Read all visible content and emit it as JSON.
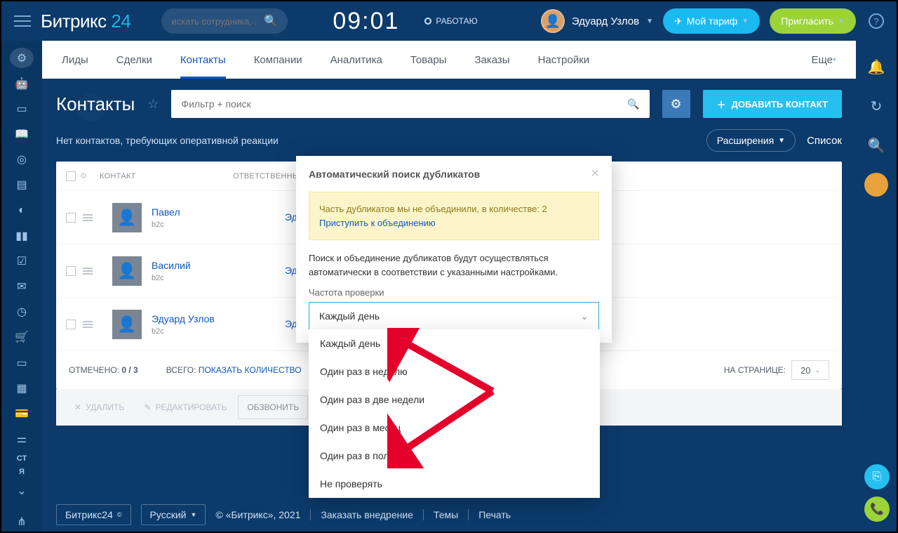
{
  "logo": {
    "a": "Битрикс",
    "b": "24"
  },
  "global_search_placeholder": "искать сотрудника, ...",
  "clock": "09:01",
  "status": "РАБОТАЮ",
  "user_name": "Эдуард Узлов",
  "btn_tarif": "Мой тариф",
  "btn_invite": "Пригласить",
  "tabs": [
    "Лиды",
    "Сделки",
    "Контакты",
    "Компании",
    "Аналитика",
    "Товары",
    "Заказы",
    "Настройки"
  ],
  "tabs_active": 2,
  "tab_more": "Еще",
  "page_title": "Контакты",
  "filter_placeholder": "Фильтр + поиск",
  "btn_add": "ДОБАВИТЬ КОНТАКТ",
  "empty_hint": "Нет контактов, требующих оперативной реакции",
  "btn_ext": "Расширения",
  "link_list": "Список",
  "thead": {
    "contact": "КОНТАКТ",
    "responsible": "ОТВЕТСТВЕННЫЙ"
  },
  "rows": [
    {
      "name": "Павел",
      "tag": "b2c",
      "responsible": "Эдуард Узлов"
    },
    {
      "name": "Василий",
      "tag": "b2c",
      "responsible": "Эдуард Узлов"
    },
    {
      "name": "Эдуард Узлов",
      "tag": "b2c",
      "responsible": "Эдуард Узлов"
    }
  ],
  "selected_label": "ОТМЕЧЕНО:",
  "selected": "0 / 3",
  "total_label": "ВСЕГО:",
  "total_link": "ПОКАЗАТЬ КОЛИЧЕСТВО",
  "per_page_label": "НА СТРАНИЦЕ:",
  "per_page": "20",
  "actions": {
    "delete": "УДАЛИТЬ",
    "edit": "РЕДАКТИРОВАТЬ",
    "call": "ОБЗВОНИТЬ"
  },
  "modal": {
    "title": "Автоматический поиск дубликатов",
    "notice_line": "Часть дубликатов мы не объединили, в количестве: 2",
    "notice_link": "Приступить к объединению",
    "desc": "Поиск и объединение дубликатов будут осуществляться автоматически в соответствии с указанными настройками.",
    "freq_label": "Частота проверки",
    "selected": "Каждый день",
    "options": [
      "Каждый день",
      "Один раз в неделю",
      "Один раз в две недели",
      "Один раз в месяц",
      "Один раз в полгода",
      "Не проверять"
    ]
  },
  "footer": {
    "brand": "Битрикс24",
    "lang": "Русский",
    "copy": "© «Битрикс», 2021",
    "impl": "Заказать внедрение",
    "themes": "Темы",
    "print": "Печать"
  },
  "rail_txt": {
    "st": "СТ",
    "ya": "Я"
  }
}
